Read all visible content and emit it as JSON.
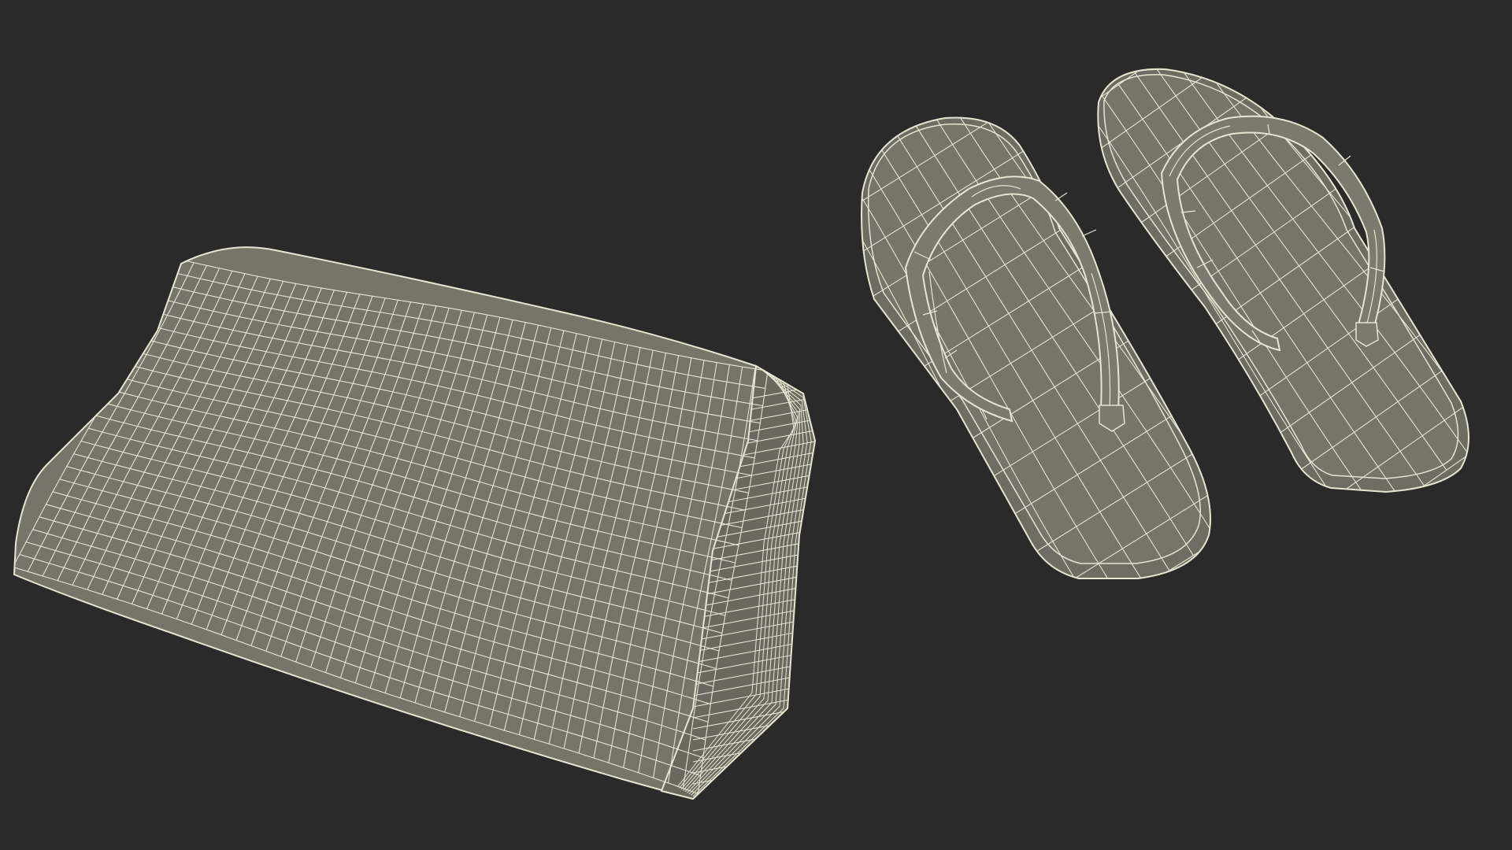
{
  "scene": {
    "objects": [
      {
        "id": "folded-towel",
        "kind": "wireframe-mesh"
      },
      {
        "id": "flip-flop-left",
        "kind": "wireframe-mesh"
      },
      {
        "id": "flip-flop-right",
        "kind": "wireframe-mesh"
      }
    ]
  },
  "colors": {
    "background": "#2a2a29",
    "mesh_fill": "#767569",
    "mesh_fill_dark": "#5f5e55",
    "wire": "#e6e4d2"
  }
}
